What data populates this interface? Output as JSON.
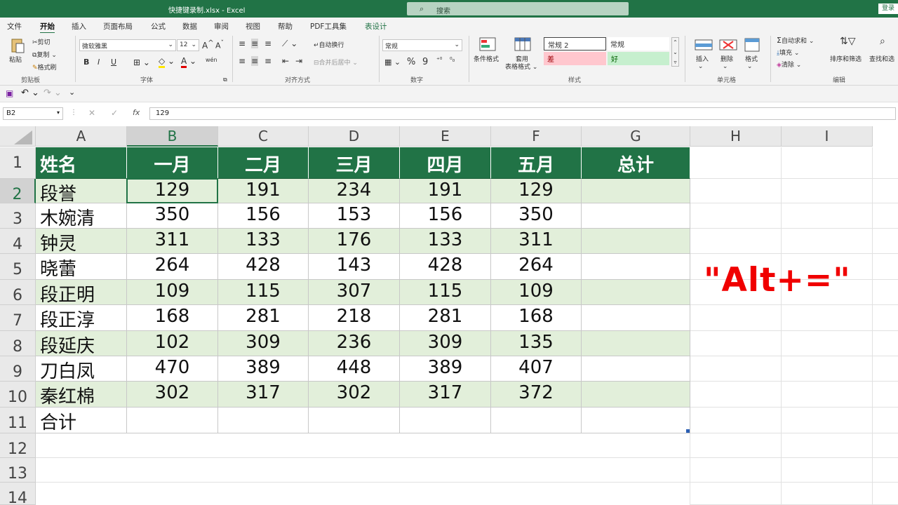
{
  "window": {
    "title": "快捷键录制.xlsx  -  Excel",
    "search_placeholder": "搜索",
    "login": "登录"
  },
  "tabs": [
    "文件",
    "开始",
    "插入",
    "页面布局",
    "公式",
    "数据",
    "审阅",
    "视图",
    "帮助",
    "PDF工具集",
    "表设计"
  ],
  "active_tab": "开始",
  "ribbon": {
    "clipboard": {
      "paste": "粘贴",
      "cut": "剪切",
      "copy": "复制",
      "format_painter": "格式刷",
      "group": "剪贴板"
    },
    "font": {
      "name": "微软雅黑",
      "size": "12",
      "bold": "B",
      "italic": "I",
      "underline": "U",
      "phonetic": "wén",
      "group": "字体"
    },
    "alignment": {
      "wrap": "自动换行",
      "merge": "合并后居中",
      "group": "对齐方式"
    },
    "number": {
      "format": "常规",
      "currency": "%",
      "comma": "9",
      "group": "数字"
    },
    "styles": {
      "conditional": "条件格式",
      "table": "套用",
      "table2": "表格格式",
      "normal2": "常规 2",
      "normal": "常规",
      "bad": "差",
      "good": "好",
      "group": "样式"
    },
    "cells": {
      "insert": "插入",
      "delete": "删除",
      "format": "格式",
      "group": "单元格"
    },
    "editing": {
      "autosum": "自动求和",
      "fill": "填充",
      "clear": "清除",
      "sort": "排序和筛选",
      "find": "查找和选",
      "group": "编辑"
    }
  },
  "formula_bar": {
    "name_box": "B2",
    "fx": "fx",
    "value": "129"
  },
  "columns": [
    "A",
    "B",
    "C",
    "D",
    "E",
    "F",
    "G",
    "H",
    "I"
  ],
  "rows": [
    "1",
    "2",
    "3",
    "4",
    "5",
    "6",
    "7",
    "8",
    "9",
    "10",
    "11",
    "12",
    "13",
    "14"
  ],
  "table": {
    "headers": [
      "姓名",
      "一月",
      "二月",
      "三月",
      "四月",
      "五月",
      "总计"
    ],
    "data": [
      [
        "段誉",
        "129",
        "191",
        "234",
        "191",
        "129",
        ""
      ],
      [
        "木婉清",
        "350",
        "156",
        "153",
        "156",
        "350",
        ""
      ],
      [
        "钟灵",
        "311",
        "133",
        "176",
        "133",
        "311",
        ""
      ],
      [
        "晓蕾",
        "264",
        "428",
        "143",
        "428",
        "264",
        ""
      ],
      [
        "段正明",
        "109",
        "115",
        "307",
        "115",
        "109",
        ""
      ],
      [
        "段正淳",
        "168",
        "281",
        "218",
        "281",
        "168",
        ""
      ],
      [
        "段延庆",
        "102",
        "309",
        "236",
        "309",
        "135",
        ""
      ],
      [
        "刀白凤",
        "470",
        "389",
        "448",
        "389",
        "407",
        ""
      ],
      [
        "秦红棉",
        "302",
        "317",
        "302",
        "317",
        "372",
        ""
      ],
      [
        "合计",
        "",
        "",
        "",
        "",
        "",
        ""
      ]
    ]
  },
  "selected_cell": "B2",
  "overlay_text": "\"Alt+=\"",
  "colors": {
    "excel_green": "#217346",
    "band": "#e2efda",
    "overlay": "#f00000"
  }
}
